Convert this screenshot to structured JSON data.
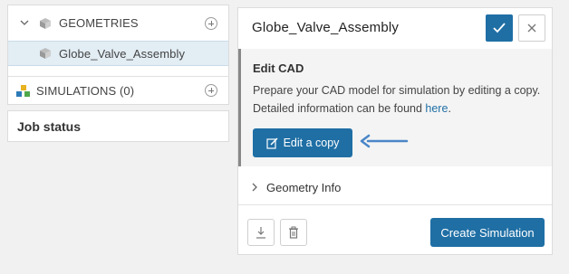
{
  "tree": {
    "geometries_label": "GEOMETRIES",
    "geometry_item_label": "Globe_Valve_Assembly",
    "simulations_label": "SIMULATIONS (0)"
  },
  "job_status": {
    "title": "Job status"
  },
  "panel": {
    "title": "Globe_Valve_Assembly",
    "edit_cad": {
      "heading": "Edit CAD",
      "description": "Prepare your CAD model for simulation by editing a copy. Detailed information can be found ",
      "link_text": "here",
      "description_end": ".",
      "button_label": "Edit a copy"
    },
    "geometry_info_label": "Geometry Info",
    "create_button_label": "Create Simulation"
  },
  "colors": {
    "primary": "#1f6fa5",
    "arrow": "#4a86c8",
    "selected_row": "#e2edf4",
    "section_bg": "#f4f4f4"
  },
  "icons": [
    "chevron-down-icon",
    "cube-icon",
    "plus-circle-icon",
    "simulation-cubes-icon",
    "check-icon",
    "close-icon",
    "edit-icon",
    "arrow-left-icon",
    "chevron-right-icon",
    "download-icon",
    "trash-icon"
  ]
}
